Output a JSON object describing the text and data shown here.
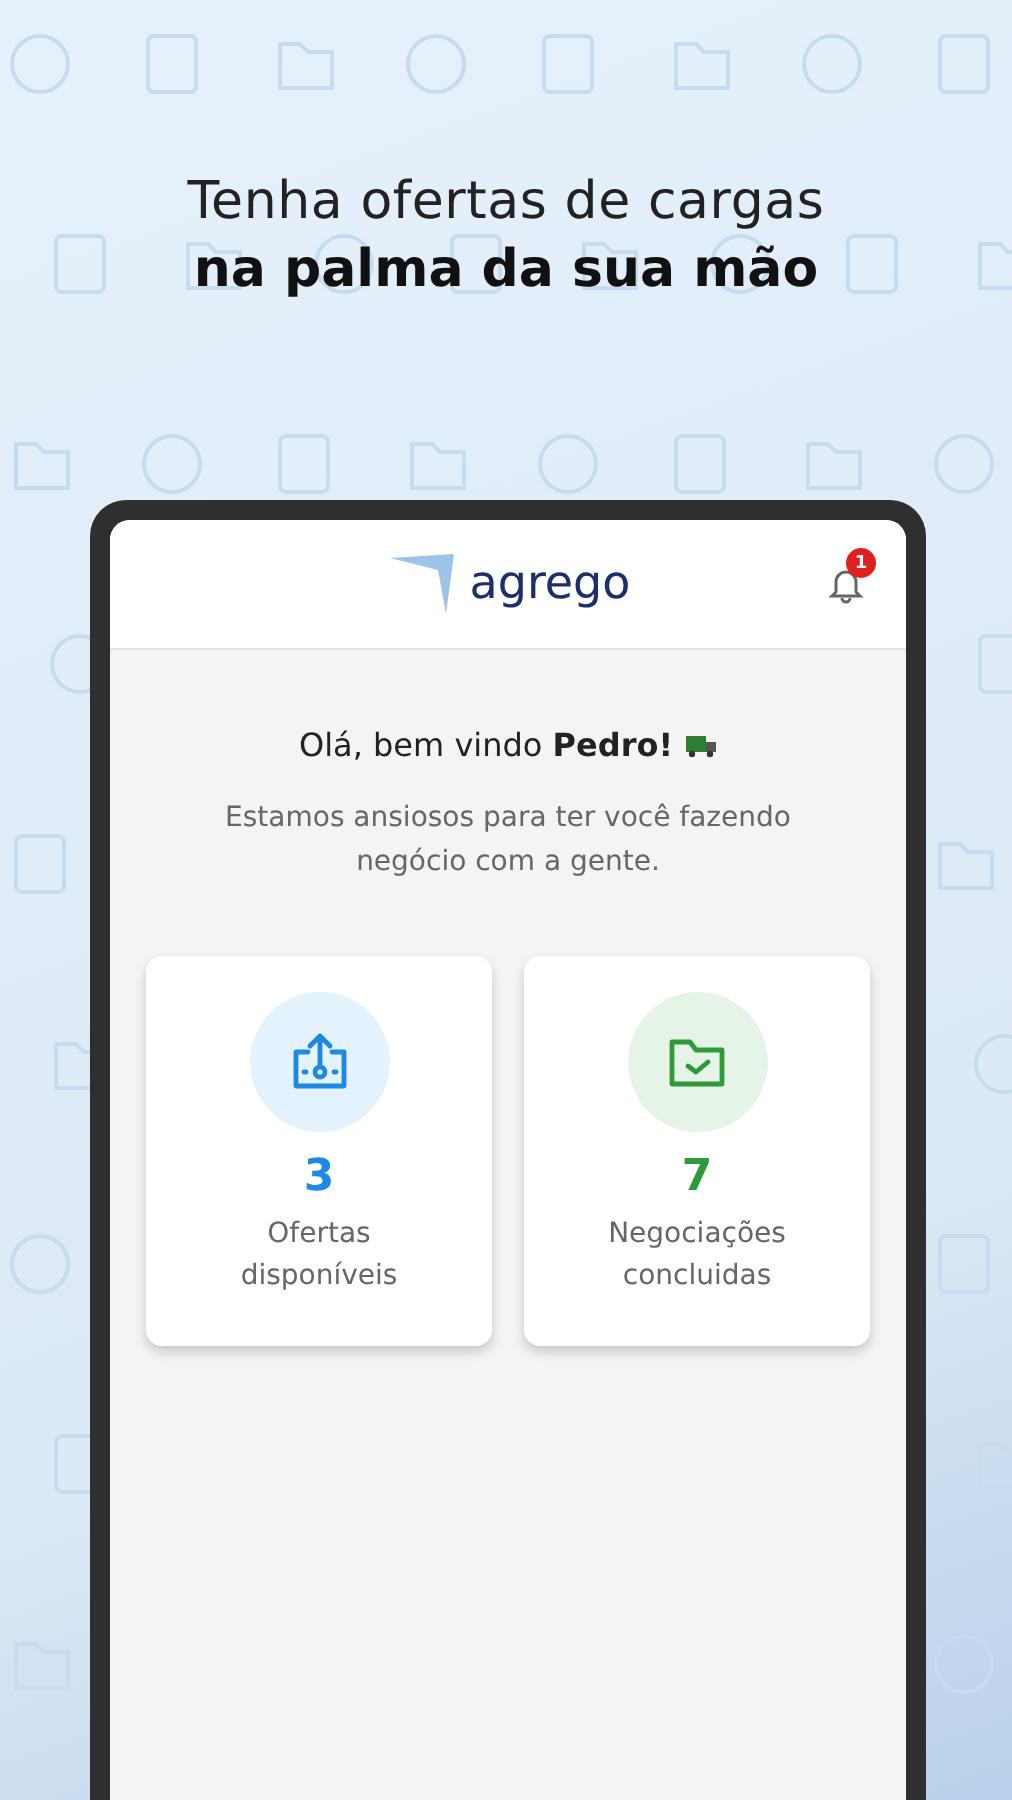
{
  "headline": {
    "line_1": "Tenha ofertas de cargas",
    "line_2": "na palma da sua mão"
  },
  "app_header": {
    "logo_text": "agrego",
    "notification_count": "1"
  },
  "greeting": "Olá, bem vindo **Pedro!**",
  "subtitle": "Estamos ansiosos para ter você fazendo negócio com a gente.",
  "cards": [
    {
      "kind": "offers",
      "color": "#1e88e5",
      "count": "3",
      "label": "Ofertas disponíveis"
    },
    {
      "kind": "deals",
      "color": "#2e9a3a",
      "count": "7",
      "label": "Negociações concluidas"
    }
  ]
}
